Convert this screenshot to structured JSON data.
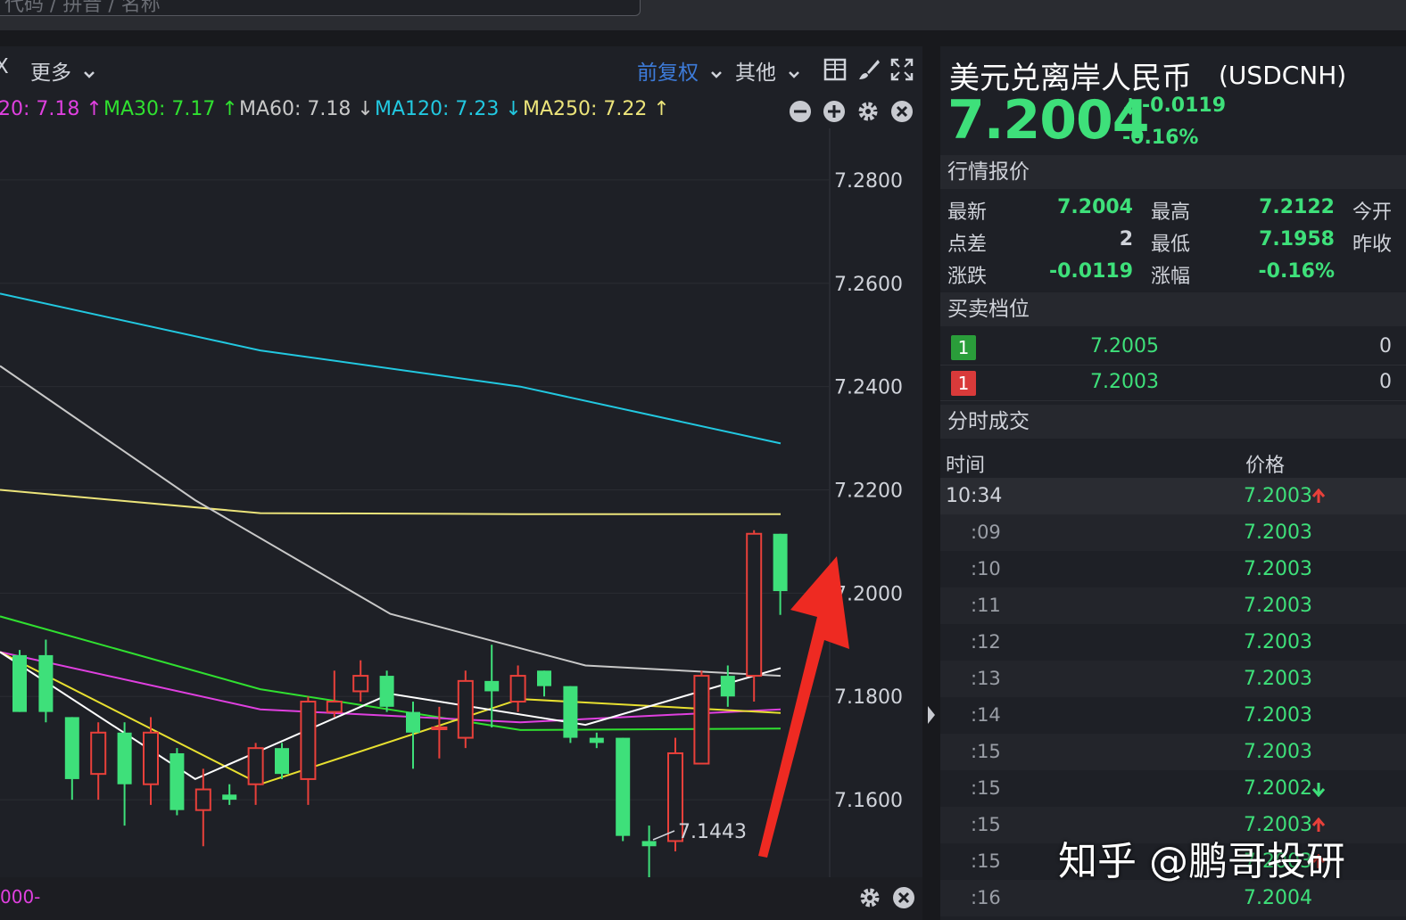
{
  "search": {
    "placeholder": "代码 / 拼音 / 名称"
  },
  "toolbar": {
    "close_partial": "X",
    "more_label": "更多",
    "adjust_label": "前复权",
    "other_label": "其他"
  },
  "ma": {
    "ma20": "20: 7.18 ↑",
    "ma30": "MA30: 7.17 ↑",
    "ma60": "MA60: 7.18 ↓",
    "ma120": "MA120: 7.23 ↓",
    "ma250": "MA250: 7.22 ↑"
  },
  "chart_data": {
    "type": "candlestick",
    "y_ticks": [
      "7.2800",
      "7.2600",
      "7.2400",
      "7.2200",
      "7.2000",
      "7.1800",
      "7.1600"
    ],
    "ylim": [
      7.145,
      7.29
    ],
    "low_annotation": "7.1443",
    "footer_label": "000-",
    "series": [
      {
        "name": "MA120",
        "color": "#22c8e0",
        "values": [
          7.258,
          7.247,
          7.24,
          7.229
        ]
      },
      {
        "name": "MA250",
        "color": "#ece47a",
        "values": [
          7.22,
          7.2155,
          7.2153,
          7.2153
        ]
      },
      {
        "name": "MA60",
        "color": "#c8c8c8",
        "values": [
          7.244,
          7.218,
          7.196,
          7.186,
          7.184
        ]
      },
      {
        "name": "MA30",
        "color": "#30e030",
        "values": [
          7.1955,
          7.1814,
          7.1735,
          7.1738
        ]
      },
      {
        "name": "MA20",
        "color": "#e040e0",
        "values": [
          7.1886,
          7.1775,
          7.175,
          7.1775
        ]
      },
      {
        "name": "MA10",
        "color": "#e8e030",
        "values": [
          7.1886,
          7.163,
          7.1795,
          7.1768
        ]
      },
      {
        "name": "MA5",
        "color": "#ffffff",
        "values": [
          7.1886,
          7.164,
          7.1805,
          7.1745,
          7.1855
        ]
      }
    ],
    "candles": [
      {
        "o": 7.188,
        "c": 7.177,
        "h": 7.189,
        "l": 7.177
      },
      {
        "o": 7.188,
        "c": 7.177,
        "h": 7.191,
        "l": 7.175
      },
      {
        "o": 7.176,
        "c": 7.164,
        "h": 7.176,
        "l": 7.16
      },
      {
        "o": 7.165,
        "c": 7.173,
        "h": 7.175,
        "l": 7.16
      },
      {
        "o": 7.173,
        "c": 7.163,
        "h": 7.175,
        "l": 7.155
      },
      {
        "o": 7.163,
        "c": 7.173,
        "h": 7.176,
        "l": 7.159
      },
      {
        "o": 7.169,
        "c": 7.158,
        "h": 7.17,
        "l": 7.157
      },
      {
        "o": 7.158,
        "c": 7.162,
        "h": 7.166,
        "l": 7.151
      },
      {
        "o": 7.161,
        "c": 7.16,
        "h": 7.163,
        "l": 7.159
      },
      {
        "o": 7.163,
        "c": 7.17,
        "h": 7.171,
        "l": 7.159
      },
      {
        "o": 7.17,
        "c": 7.165,
        "h": 7.171,
        "l": 7.164
      },
      {
        "o": 7.164,
        "c": 7.179,
        "h": 7.18,
        "l": 7.159
      },
      {
        "o": 7.177,
        "c": 7.179,
        "h": 7.185,
        "l": 7.176
      },
      {
        "o": 7.181,
        "c": 7.184,
        "h": 7.187,
        "l": 7.179
      },
      {
        "o": 7.184,
        "c": 7.178,
        "h": 7.185,
        "l": 7.177
      },
      {
        "o": 7.177,
        "c": 7.173,
        "h": 7.179,
        "l": 7.166
      },
      {
        "o": 7.174,
        "c": 7.174,
        "h": 7.178,
        "l": 7.168
      },
      {
        "o": 7.172,
        "c": 7.183,
        "h": 7.185,
        "l": 7.17
      },
      {
        "o": 7.183,
        "c": 7.181,
        "h": 7.19,
        "l": 7.174
      },
      {
        "o": 7.179,
        "c": 7.184,
        "h": 7.186,
        "l": 7.177
      },
      {
        "o": 7.185,
        "c": 7.182,
        "h": 7.185,
        "l": 7.18
      },
      {
        "o": 7.182,
        "c": 7.172,
        "h": 7.182,
        "l": 7.171
      },
      {
        "o": 7.172,
        "c": 7.171,
        "h": 7.173,
        "l": 7.17
      },
      {
        "o": 7.172,
        "c": 7.153,
        "h": 7.172,
        "l": 7.152
      },
      {
        "o": 7.152,
        "c": 7.151,
        "h": 7.155,
        "l": 7.1443
      },
      {
        "o": 7.152,
        "c": 7.169,
        "h": 7.172,
        "l": 7.15
      },
      {
        "o": 7.167,
        "c": 7.184,
        "h": 7.185,
        "l": 7.167
      },
      {
        "o": 7.184,
        "c": 7.18,
        "h": 7.186,
        "l": 7.178
      },
      {
        "o": 7.184,
        "c": 7.2115,
        "h": 7.2122,
        "l": 7.179
      },
      {
        "o": 7.2115,
        "c": 7.2004,
        "h": 7.2115,
        "l": 7.1958
      }
    ]
  },
  "quote": {
    "name": "美元兑离岸人民币",
    "code": "(USDCNH)",
    "price": "7.2004",
    "change": "-0.0119",
    "change_pct": "-0.16%",
    "section_quote": "行情报价",
    "fields": {
      "latest_label": "最新",
      "latest": "7.2004",
      "high_label": "最高",
      "high": "7.2122",
      "open_label": "今开",
      "spread_label": "点差",
      "spread": "2",
      "low_label": "最低",
      "low": "7.1958",
      "prev_label": "昨收",
      "chg_label": "涨跌",
      "chg": "-0.0119",
      "pct_label": "涨幅",
      "pct": "-0.16%"
    },
    "section_book": "买卖档位",
    "book": [
      {
        "level": "1",
        "price": "7.2005",
        "volume": "0",
        "color": "#2a9d3a"
      },
      {
        "level": "1",
        "price": "7.2003",
        "volume": "0",
        "color": "#d93a3a"
      }
    ],
    "section_ticks": "分时成交",
    "ticks_header": {
      "time": "时间",
      "price": "价格"
    },
    "ticks": [
      {
        "time": "10:34",
        "price": "7.2003",
        "dir": "up"
      },
      {
        "time": ":09",
        "price": "7.2003",
        "dir": ""
      },
      {
        "time": ":10",
        "price": "7.2003",
        "dir": ""
      },
      {
        "time": ":11",
        "price": "7.2003",
        "dir": ""
      },
      {
        "time": ":12",
        "price": "7.2003",
        "dir": ""
      },
      {
        "time": ":13",
        "price": "7.2003",
        "dir": ""
      },
      {
        "time": ":14",
        "price": "7.2003",
        "dir": ""
      },
      {
        "time": ":15",
        "price": "7.2003",
        "dir": ""
      },
      {
        "time": ":15",
        "price": "7.2002",
        "dir": "down"
      },
      {
        "time": ":15",
        "price": "7.2003",
        "dir": "up"
      },
      {
        "time": ":15",
        "price": "7.2003",
        "dir": "up"
      },
      {
        "time": ":16",
        "price": "7.2004",
        "dir": ""
      }
    ]
  },
  "watermark": "知乎 @鹏哥投研",
  "colors": {
    "up": "#e8403a",
    "down": "#3ee07a",
    "accent_blue": "#3d7bd9",
    "arrow": "#ee2a22"
  }
}
